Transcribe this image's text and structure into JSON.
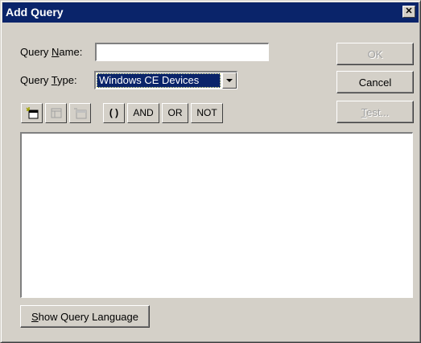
{
  "window": {
    "title": "Add Query",
    "close_glyph": "✕"
  },
  "form": {
    "query_name": {
      "label_before": "Query ",
      "label_mnemonic": "N",
      "label_after": "ame:",
      "value": ""
    },
    "query_type": {
      "label_before": "Query ",
      "label_mnemonic": "T",
      "label_after": "ype:",
      "selected": "Windows CE Devices"
    }
  },
  "buttons": {
    "ok": "OK",
    "cancel": "Cancel",
    "test": {
      "mnemonic": "T",
      "rest": "est..."
    },
    "show_query": {
      "mnemonic": "S",
      "rest": "how Query Language"
    }
  },
  "toolbar": {
    "parens": "( )",
    "and": "AND",
    "or": "OR",
    "not": "NOT",
    "icons": [
      "new-criterion-icon",
      "properties-icon",
      "delete-criterion-icon"
    ]
  },
  "colors": {
    "titlebar": "#0a246a",
    "face": "#d4d0c8",
    "selection": "#0a246a"
  }
}
